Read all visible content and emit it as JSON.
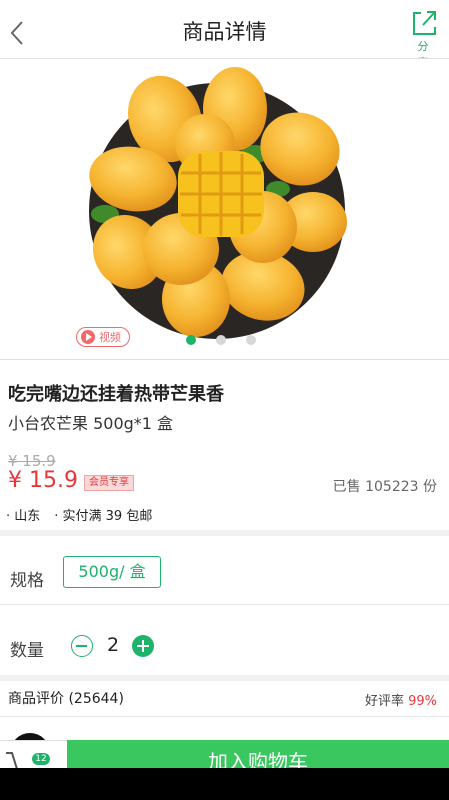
{
  "header": {
    "title": "商品详情",
    "share_label": "分 享"
  },
  "gallery": {
    "video_label": "视频",
    "slide_count": 3,
    "active_slide": 1
  },
  "product": {
    "title": "吃完嘴边还挂着热带芒果香",
    "subtitle": "小台农芒果 500g*1 盒",
    "original_price": "¥ 15.9",
    "price": "¥ 15.9",
    "member_tag": "会员专享",
    "sold": "已售 105223 份",
    "tags": [
      "· 山东",
      "· 实付满 39 包邮"
    ]
  },
  "spec": {
    "label": "规格",
    "value": "500g/ 盒"
  },
  "quantity": {
    "label": "数量",
    "value": "2"
  },
  "reviews": {
    "label": "商品评价 (25644)",
    "rating_label": "好评率 ",
    "rating_value": "99%"
  },
  "bottom": {
    "cart_count": "12",
    "add_to_cart": "加入购物车"
  },
  "colors": {
    "accent": "#1db36b",
    "price": "#e8373b",
    "button": "#3ac760"
  }
}
